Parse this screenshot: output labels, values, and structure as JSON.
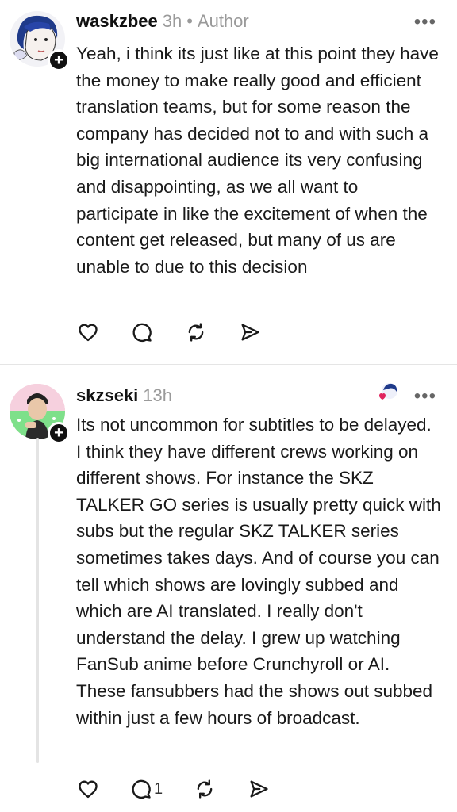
{
  "comments": [
    {
      "username": "waskzbee",
      "time": "3h",
      "separator": "•",
      "badge": "Author",
      "more": "•••",
      "text": "Yeah, i think its just like at this point they have the money to make really good and efficient translation teams, but for some reason the company has decided not to and with such a big international audience its very confusing and disappointing, as we all want to participate in like the excitement of when the content get released, but many of us are unable to due to this decision"
    },
    {
      "username": "skzseki",
      "time": "13h",
      "more": "•••",
      "reply_count": "1",
      "text": "Its not uncommon for subtitles to be delayed. I think they have different crews working on different shows. For instance the SKZ TALKER GO series is usually pretty quick with subs but the regular SKZ TALKER series sometimes takes days. And of course you can tell which shows are lovingly subbed and which are AI translated. I really don't understand the delay. I grew up watching FanSub anime before Crunchyroll or AI. These fansubbers had the shows out subbed within just a few hours of broadcast."
    }
  ],
  "plus": "+",
  "icons": [
    "heart-icon",
    "comment-icon",
    "repost-icon",
    "share-icon",
    "plus-icon",
    "more-icon"
  ],
  "colors": {
    "muted": "#9a9a9a",
    "text": "#1a1a1a",
    "divider": "#e5e5e5",
    "heart": "#e0245e"
  }
}
